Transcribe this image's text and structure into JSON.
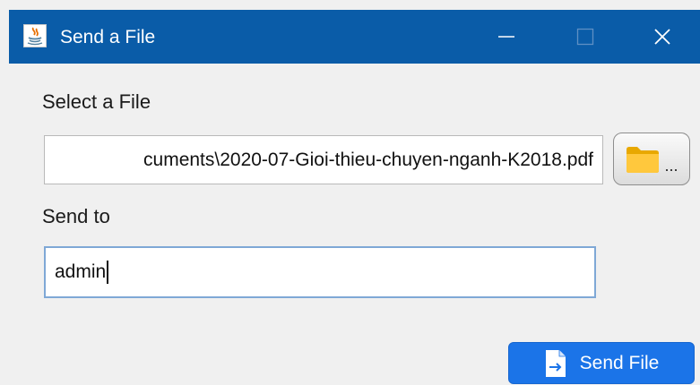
{
  "window": {
    "title": "Send a File",
    "title_bar_color": "#0a5ca8",
    "icons": [
      "java-app-icon",
      "minimize-icon",
      "maximize-icon",
      "close-icon"
    ]
  },
  "form": {
    "select_label": "Select a File",
    "file_path_value": "cuments\\2020-07-Gioi-thieu-chuyen-nganh-K2018.pdf",
    "browse_button_label": "...",
    "browse_icon": "folder-icon",
    "send_to_label": "Send to",
    "send_to_value": "admin"
  },
  "actions": {
    "send_button_label": "Send File",
    "send_icon": "send-file-icon",
    "accent_color": "#1b74e8"
  }
}
